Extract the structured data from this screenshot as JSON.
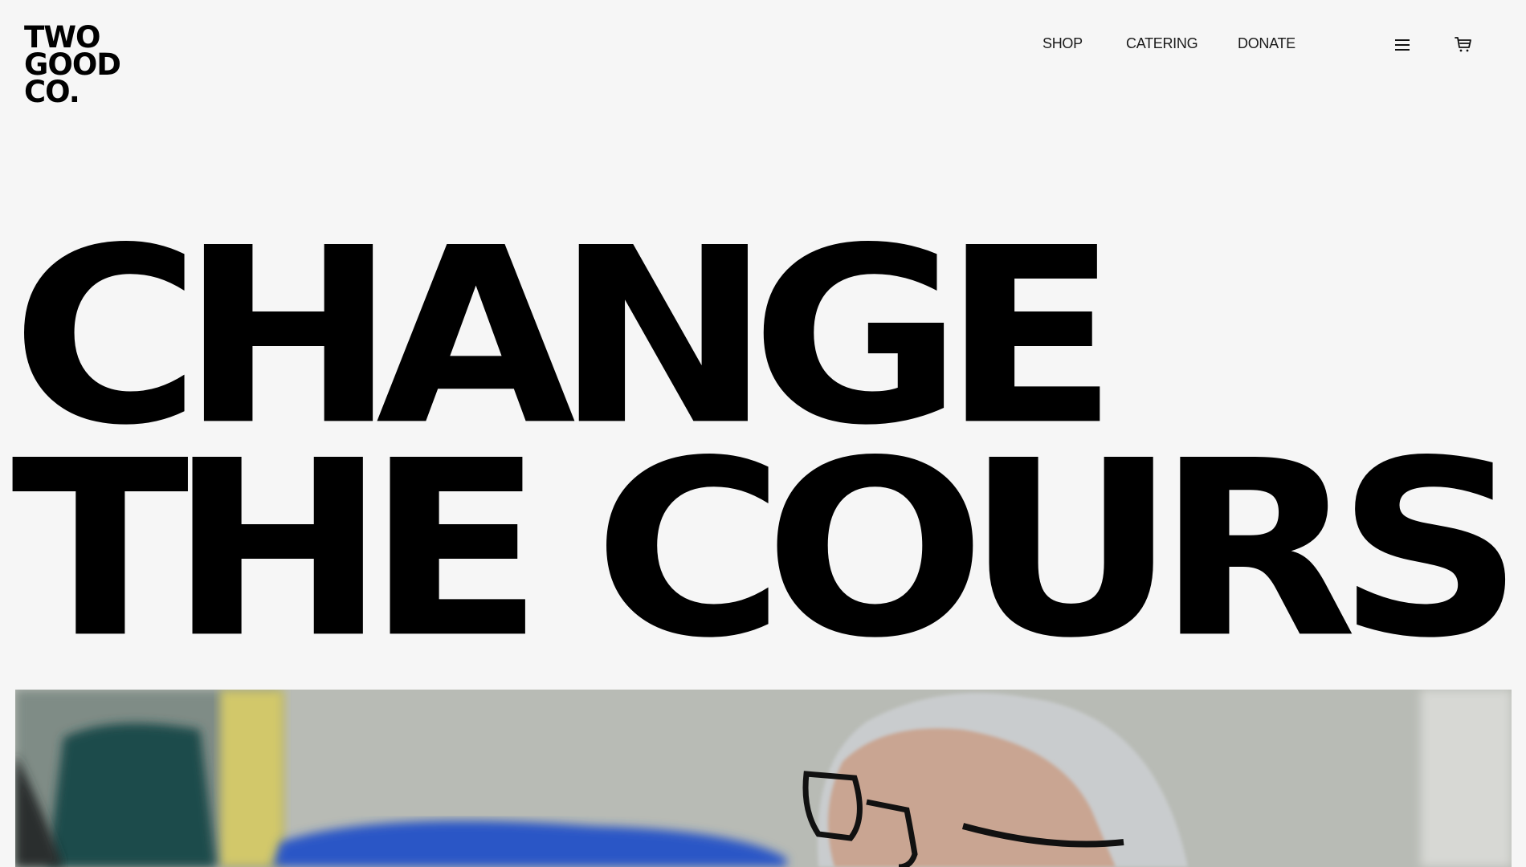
{
  "header": {
    "logo_lines": [
      "TWO",
      "GOOD",
      "CO."
    ],
    "nav": {
      "shop": "SHOP",
      "catering": "CATERING",
      "donate": "DONATE"
    },
    "menu_icon": "hamburger-menu-icon",
    "cart_icon": "shopping-cart-icon"
  },
  "hero": {
    "headline_line1": "CHANGE",
    "headline_line2": "THE COURSE"
  },
  "colors": {
    "background": "#f6f6f6",
    "text": "#000000"
  }
}
